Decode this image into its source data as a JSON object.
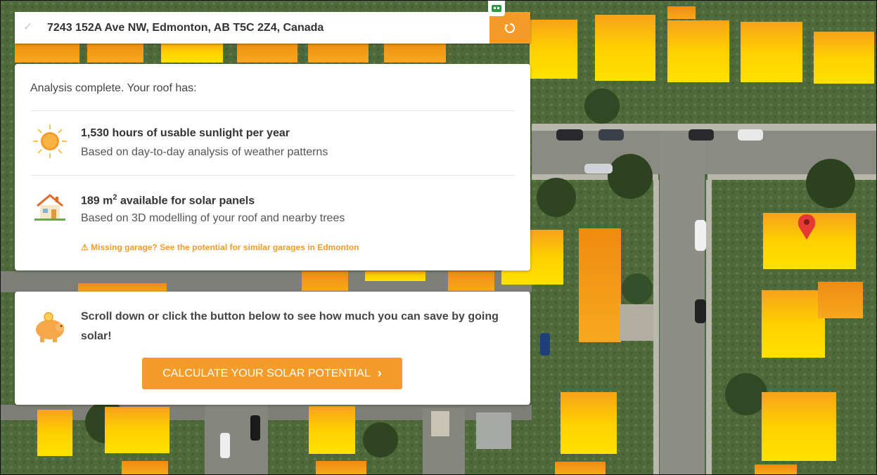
{
  "search": {
    "address": "7243 152A Ave NW, Edmonton, AB T5C 2Z4, Canada",
    "check_icon": "check-icon",
    "reset_icon": "refresh-icon"
  },
  "analysis": {
    "intro": "Analysis complete. Your roof has:",
    "sunlight": {
      "title": "1,530 hours of usable sunlight per year",
      "subtitle": "Based on day-to-day analysis of weather patterns",
      "icon": "sun-icon"
    },
    "area": {
      "title_value": "189 m",
      "title_sup": "2",
      "title_rest": " available for solar panels",
      "subtitle": "Based on 3D modelling of your roof and nearby trees",
      "icon": "house-icon"
    },
    "warning": "Missing garage? See the potential for similar garages in Edmonton"
  },
  "cta": {
    "text": "Scroll down or click the button below to see how much you can save by going solar!",
    "button_label": "CALCULATE YOUR SOLAR POTENTIAL",
    "icon": "piggy-bank-icon"
  },
  "colors": {
    "accent": "#f49b2a",
    "roof_hot": "#ffd200",
    "roof_warm": "#f58a12",
    "marker": "#e53935"
  }
}
